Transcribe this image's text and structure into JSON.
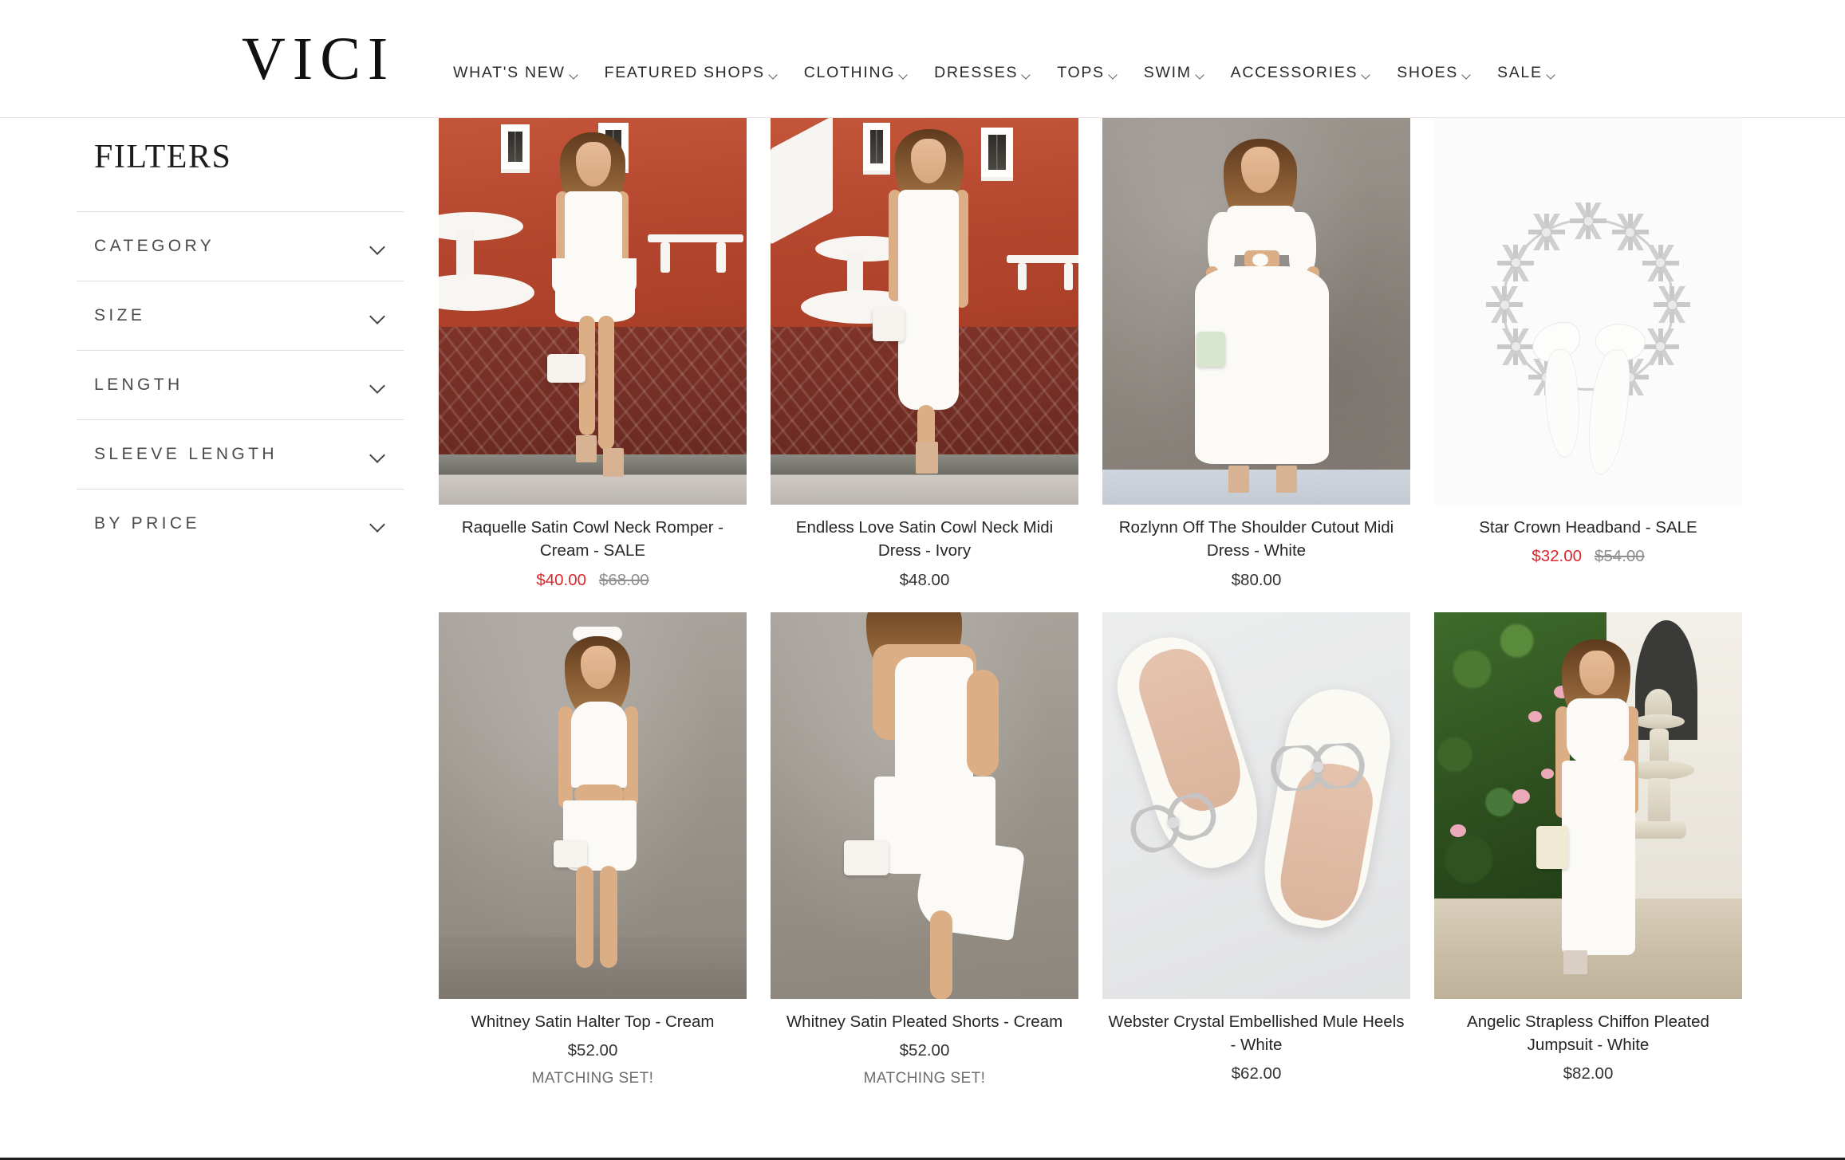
{
  "header": {
    "logo": "VICI",
    "nav": [
      {
        "label": "WHAT'S NEW",
        "icon": "chevron-down-icon"
      },
      {
        "label": "FEATURED SHOPS",
        "icon": "chevron-down-icon"
      },
      {
        "label": "CLOTHING",
        "icon": "chevron-down-icon"
      },
      {
        "label": "DRESSES",
        "icon": "chevron-down-icon"
      },
      {
        "label": "TOPS",
        "icon": "chevron-down-icon"
      },
      {
        "label": "SWIM",
        "icon": "chevron-down-icon"
      },
      {
        "label": "ACCESSORIES",
        "icon": "chevron-down-icon"
      },
      {
        "label": "SHOES",
        "icon": "chevron-down-icon"
      },
      {
        "label": "SALE",
        "icon": "chevron-down-icon"
      }
    ]
  },
  "sidebar": {
    "title": "FILTERS",
    "filters": [
      {
        "label": "CATEGORY",
        "icon": "chevron-down-icon"
      },
      {
        "label": "SIZE",
        "icon": "chevron-down-icon"
      },
      {
        "label": "LENGTH",
        "icon": "chevron-down-icon"
      },
      {
        "label": "SLEEVE LENGTH",
        "icon": "chevron-down-icon"
      },
      {
        "label": "BY PRICE",
        "icon": "chevron-down-icon"
      }
    ]
  },
  "colors": {
    "sale_price": "#d8292f",
    "original_price": "#8f8f8f",
    "text": "#262626",
    "badge": "#6e6e6e"
  },
  "products": [
    {
      "title": "Raquelle Satin Cowl Neck Romper - Cream - SALE",
      "price": "$40.00",
      "original_price": "$68.00",
      "on_sale": true,
      "badge": "",
      "scene": "terracotta-romper"
    },
    {
      "title": "Endless Love Satin Cowl Neck Midi Dress - Ivory",
      "price": "$48.00",
      "original_price": "",
      "on_sale": false,
      "badge": "",
      "scene": "terracotta-midi"
    },
    {
      "title": "Rozlynn Off The Shoulder Cutout Midi Dress - White",
      "price": "$80.00",
      "original_price": "",
      "on_sale": false,
      "badge": "",
      "scene": "gray-wall-maxi"
    },
    {
      "title": "Star Crown Headband - SALE",
      "price": "$32.00",
      "original_price": "$54.00",
      "on_sale": true,
      "badge": "",
      "scene": "headband"
    },
    {
      "title": "Whitney Satin Halter Top - Cream",
      "price": "$52.00",
      "original_price": "",
      "on_sale": false,
      "badge": "MATCHING SET!",
      "scene": "studio-halter"
    },
    {
      "title": "Whitney Satin Pleated Shorts - Cream",
      "price": "$52.00",
      "original_price": "",
      "on_sale": false,
      "badge": "MATCHING SET!",
      "scene": "studio-shorts"
    },
    {
      "title": "Webster Crystal Embellished Mule Heels - White",
      "price": "$62.00",
      "original_price": "",
      "on_sale": false,
      "badge": "",
      "scene": "mule-heels"
    },
    {
      "title": "Angelic Strapless Chiffon Pleated Jumpsuit - White",
      "price": "$82.00",
      "original_price": "",
      "on_sale": false,
      "badge": "",
      "scene": "garden-jumpsuit"
    }
  ]
}
